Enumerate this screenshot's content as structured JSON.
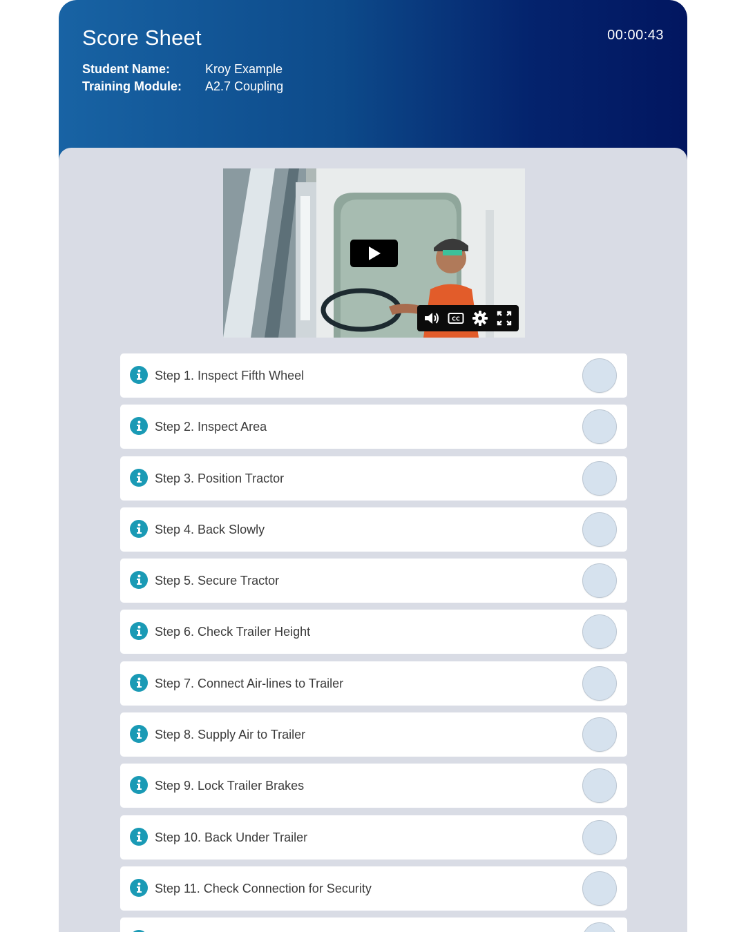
{
  "header": {
    "title": "Score Sheet",
    "timer": "00:00:43",
    "student_label": "Student Name:",
    "student_value": "Kroy Example",
    "module_label": "Training Module:",
    "module_value": "A2.7 Coupling"
  },
  "video": {
    "controls": [
      "volume-icon",
      "closed-captions-icon",
      "settings-gear-icon",
      "fullscreen-icon"
    ],
    "captions_text": "CC"
  },
  "steps": [
    {
      "label": "Step 1. Inspect Fifth Wheel"
    },
    {
      "label": "Step 2. Inspect Area"
    },
    {
      "label": "Step 3. Position Tractor"
    },
    {
      "label": "Step 4. Back Slowly"
    },
    {
      "label": "Step 5. Secure Tractor"
    },
    {
      "label": "Step 6. Check Trailer Height"
    },
    {
      "label": "Step 7. Connect Air-lines to Trailer"
    },
    {
      "label": "Step 8. Supply Air to Trailer"
    },
    {
      "label": "Step 9. Lock Trailer Brakes"
    },
    {
      "label": "Step 10. Back Under Trailer"
    },
    {
      "label": "Step 11. Check Connection for Security"
    },
    {
      "label": ""
    }
  ],
  "colors": {
    "header_start": "#1863a4",
    "header_end": "#021660",
    "content_bg": "#d9dce5",
    "info_icon": "#1a9ab5",
    "check_circle": "#d6e2ee"
  }
}
